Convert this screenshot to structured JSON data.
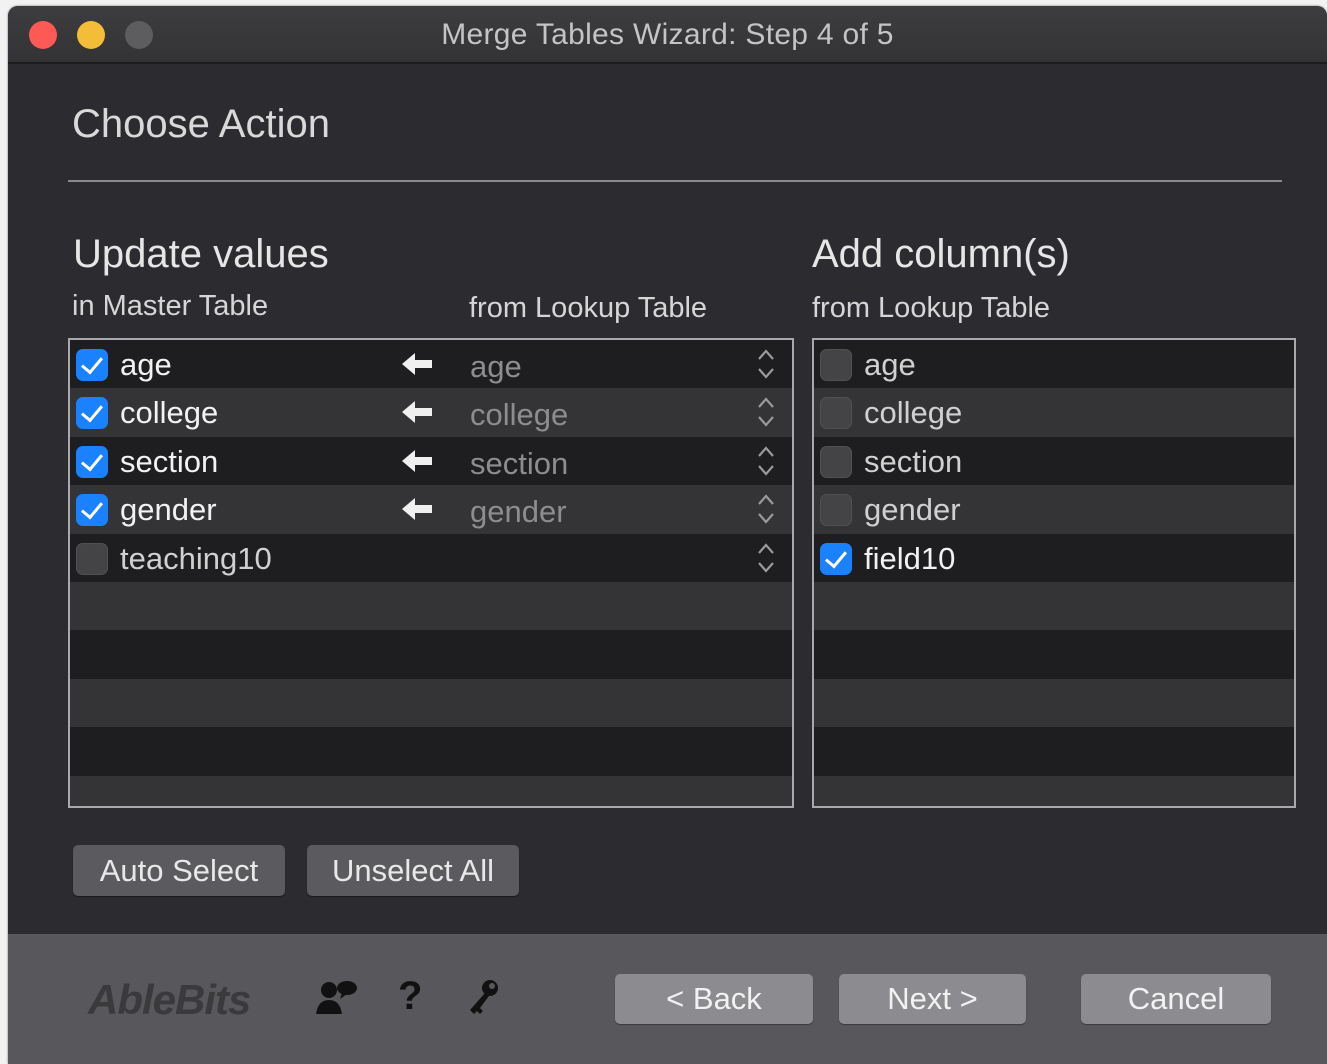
{
  "window": {
    "title": "Merge Tables Wizard: Step 4 of 5"
  },
  "page": {
    "heading": "Choose Action"
  },
  "update": {
    "title": "Update values",
    "master_sub": "in Master Table",
    "lookup_sub": "from Lookup Table",
    "rows": [
      {
        "checked": true,
        "master": "age",
        "lookup": "age"
      },
      {
        "checked": true,
        "master": "college",
        "lookup": "college"
      },
      {
        "checked": true,
        "master": "section",
        "lookup": "section"
      },
      {
        "checked": true,
        "master": "gender",
        "lookup": "gender"
      },
      {
        "checked": false,
        "master": "teaching10",
        "lookup": ""
      }
    ]
  },
  "add": {
    "title": "Add column(s)",
    "sub": "from Lookup Table",
    "rows": [
      {
        "checked": false,
        "label": "age"
      },
      {
        "checked": false,
        "label": "college"
      },
      {
        "checked": false,
        "label": "section"
      },
      {
        "checked": false,
        "label": "gender"
      },
      {
        "checked": true,
        "label": "field10"
      }
    ]
  },
  "buttons": {
    "auto_select": "Auto Select",
    "unselect_all": "Unselect All",
    "back": "< Back",
    "next": "Next >",
    "cancel": "Cancel"
  },
  "footer": {
    "logo": "AbleBits",
    "help_glyph": "?"
  },
  "colors": {
    "checkbox_on": "#1a82ff",
    "window_bg": "#2b2b30",
    "footer_bg": "#58585c"
  },
  "icons": [
    "close-icon",
    "minimize-icon",
    "zoom-icon",
    "left-arrow-icon",
    "stepper-icon",
    "users-icon",
    "help-icon",
    "key-icon"
  ]
}
